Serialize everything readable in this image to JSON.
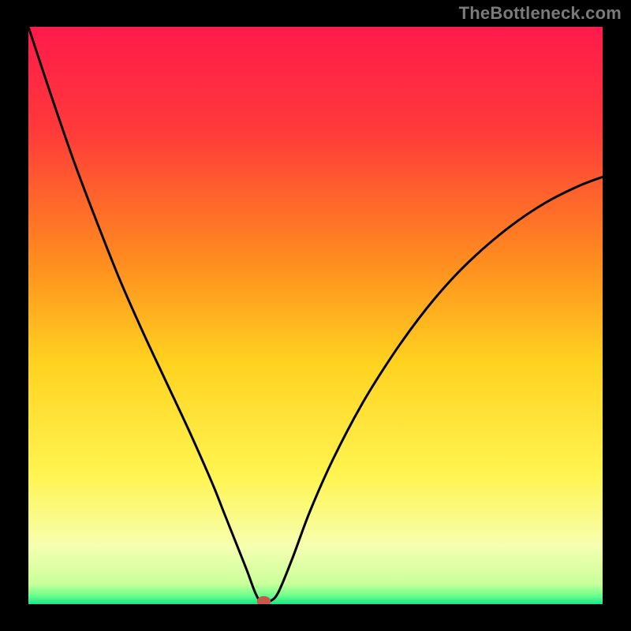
{
  "watermark": "TheBottleneck.com",
  "chart_data": {
    "type": "line",
    "title": "",
    "xlabel": "",
    "ylabel": "",
    "xlim": [
      0,
      100
    ],
    "ylim": [
      0,
      100
    ],
    "grid": false,
    "legend": false,
    "background_gradient": {
      "stops": [
        {
          "pos": 0.0,
          "color": "#ff1a4b"
        },
        {
          "pos": 0.18,
          "color": "#ff3a3a"
        },
        {
          "pos": 0.4,
          "color": "#ff8a1f"
        },
        {
          "pos": 0.58,
          "color": "#ffd21f"
        },
        {
          "pos": 0.78,
          "color": "#fff552"
        },
        {
          "pos": 0.9,
          "color": "#f6ffb0"
        },
        {
          "pos": 0.965,
          "color": "#c9ff9a"
        },
        {
          "pos": 0.985,
          "color": "#6bff8c"
        },
        {
          "pos": 1.0,
          "color": "#19e38a"
        }
      ]
    },
    "series": [
      {
        "name": "curve",
        "color": "#000000",
        "x": [
          0,
          4,
          8,
          12,
          16,
          20,
          24,
          28,
          32,
          34,
          36,
          38,
          39.5,
          40.5,
          42,
          43.5,
          46,
          49,
          53,
          58,
          63,
          68,
          73,
          78,
          84,
          90,
          96,
          100
        ],
        "y": [
          100,
          88,
          76.5,
          66,
          56,
          47,
          38.5,
          30,
          21,
          16,
          11,
          6,
          2,
          0.5,
          0.5,
          2,
          8,
          16,
          25,
          34.5,
          42.5,
          49.5,
          55.5,
          60.5,
          65.5,
          69.5,
          72.5,
          74
        ]
      }
    ],
    "marker": {
      "name": "min-point",
      "x": 41,
      "y": 0.5,
      "color": "#c55a4a",
      "rx": 1.2,
      "ry": 0.9
    }
  }
}
